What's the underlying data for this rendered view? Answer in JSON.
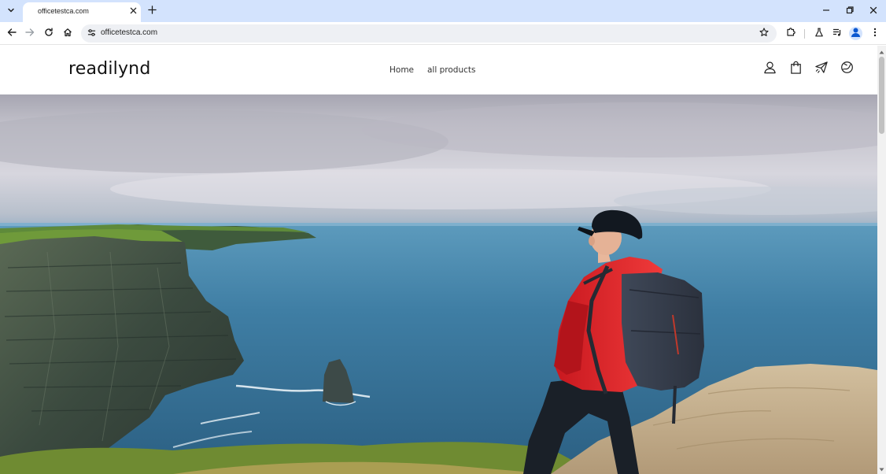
{
  "browser": {
    "tab": {
      "title": "officetestca.com",
      "close_icon": "close-icon"
    },
    "new_tab_icon": "plus-icon",
    "tab_list_icon": "chevron-down-icon",
    "window_controls": [
      "minimize-icon",
      "restore-icon",
      "close-icon"
    ],
    "toolbar": {
      "back_icon": "back-arrow-icon",
      "forward_icon": "forward-arrow-icon",
      "reload_icon": "reload-icon",
      "home_icon": "home-icon",
      "site_info_icon": "tune-icon",
      "url": "officetestca.com",
      "bookmark_icon": "star-icon",
      "extensions_icon": "puzzle-icon",
      "labs_icon": "flask-icon",
      "media_icon": "playlist-icon",
      "profile_icon": "person-icon",
      "menu_icon": "kebab-menu-icon"
    },
    "colors": {
      "titlebar": "#d3e3fd",
      "omnibox": "#eef0f4",
      "profile_accent": "#0b57d0"
    }
  },
  "site": {
    "logo": "readilynd",
    "nav": [
      {
        "label": "Home"
      },
      {
        "label": "all products"
      }
    ],
    "header_icons": [
      "account-icon",
      "cart-icon",
      "paper-plane-icon",
      "globe-icon"
    ],
    "hero": {
      "image": "hiker-with-backpack-on-sea-cliffs-photo",
      "colors": {
        "sky": "#c9c8d2",
        "sea": "#3f7fa8",
        "jacket": "#d8262a",
        "grass": "#5e8f2e"
      }
    }
  }
}
